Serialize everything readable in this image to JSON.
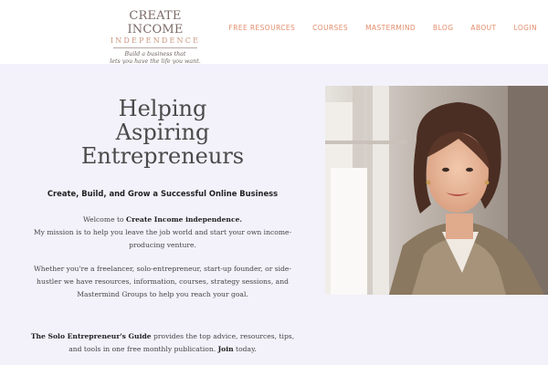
{
  "header": {
    "logo": {
      "line1": "CREATE INCOME",
      "line2": "INDEPENDENCE",
      "tagline1": "Build a business that",
      "tagline2": "lets you have the life you want."
    },
    "nav": [
      {
        "label": "FREE RESOURCES"
      },
      {
        "label": "COURSES"
      },
      {
        "label": "MASTERMIND"
      },
      {
        "label": "BLOG"
      },
      {
        "label": "ABOUT"
      },
      {
        "label": "LOGIN"
      }
    ],
    "accent_color": "#e48d6c"
  },
  "hero": {
    "headline": [
      "Helping",
      "Aspiring",
      "Entrepreneurs"
    ],
    "subhead": "Create, Build, and Grow a Successful Online Business",
    "p1_prefix": "Welcome to ",
    "p1_bold": "Create Income independence.",
    "p1_line2": "My mission is to help you leave the job world and start your own income-producing venture.",
    "p2": "Whether you're a freelancer, solo-entrepreneur, start-up founder, or side-hustler we have resources, information, courses, strategy sessions, and Mastermind Groups to help you reach your goal.",
    "p3_bold": "The Solo Entrepreneur's Guide",
    "p3_text": " provides the top advice, resources, tips, and tools in one free monthly publication. ",
    "p3_link": "Join",
    "p3_end": " today.",
    "background_color": "#f3f2fb"
  }
}
